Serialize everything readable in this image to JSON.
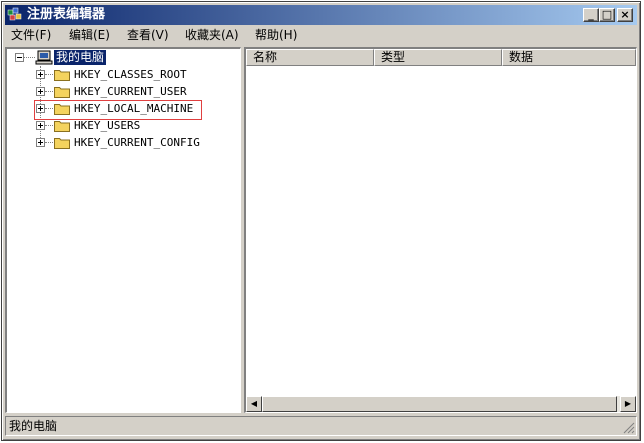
{
  "window": {
    "title": "注册表编辑器",
    "minimize_glyph": "_",
    "maximize_glyph": "□",
    "close_glyph": "×"
  },
  "menu": [
    {
      "label": "文件(F)"
    },
    {
      "label": "编辑(E)"
    },
    {
      "label": "查看(V)"
    },
    {
      "label": "收藏夹(A)"
    },
    {
      "label": "帮助(H)"
    }
  ],
  "tree": {
    "root": "我的电脑",
    "items": [
      {
        "label": "HKEY_CLASSES_ROOT"
      },
      {
        "label": "HKEY_CURRENT_USER"
      },
      {
        "label": "HKEY_LOCAL_MACHINE"
      },
      {
        "label": "HKEY_USERS"
      },
      {
        "label": "HKEY_CURRENT_CONFIG"
      }
    ]
  },
  "list": {
    "columns": [
      {
        "label": "名称"
      },
      {
        "label": "类型"
      },
      {
        "label": "数据"
      }
    ]
  },
  "scrollbar": {
    "left_arrow": "◀",
    "right_arrow": "▶"
  },
  "status": {
    "text": "我的电脑"
  },
  "colors": {
    "title_gradient_start": "#0a246a",
    "title_gradient_end": "#a6caf0",
    "selection": "#0a246a",
    "highlight_box": "#e04040",
    "folder": "#f4d35e"
  }
}
